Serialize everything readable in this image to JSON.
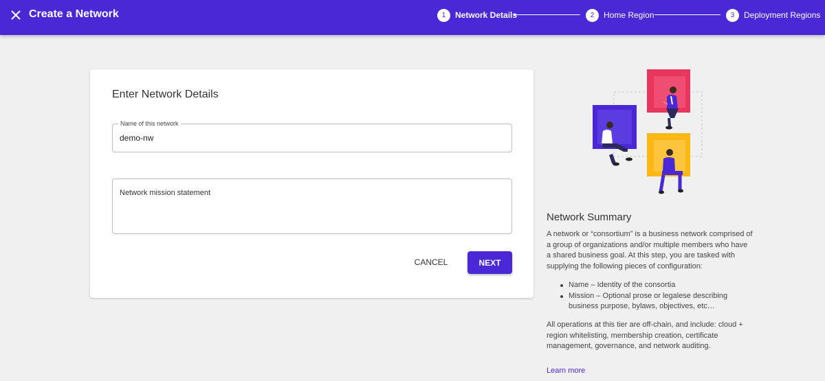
{
  "header": {
    "title": "Create a Network",
    "steps": [
      {
        "number": "1",
        "label": "Network Details"
      },
      {
        "number": "2",
        "label": "Home Region"
      },
      {
        "number": "3",
        "label": "Deployment Regions"
      }
    ]
  },
  "form": {
    "title": "Enter Network Details",
    "name_label": "Name of this network",
    "name_value": "demo-nw",
    "mission_placeholder": "Network mission statement",
    "cancel_label": "CANCEL",
    "next_label": "NEXT"
  },
  "summary": {
    "title": "Network Summary",
    "paragraph1": "A network or “consortium” is a business network comprised of a group of organizations and/or multiple members who have a shared business goal. At this step, you are tasked with supplying the following pieces of configuration:",
    "bullets": [
      "Name – Identity of the consortia",
      "Mission – Optional prose or legalese describing business purpose, bylaws, objectives, etc…"
    ],
    "paragraph2": "All operations at this tier are off-chain, and include: cloud + region whitelisting, membership creation, certificate management, governance, and network auditing.",
    "learn_more": "Learn more"
  },
  "colors": {
    "primary": "#4a28d6",
    "pink": "#e8365f",
    "yellow": "#fbb814",
    "background": "#f0f0f0"
  }
}
